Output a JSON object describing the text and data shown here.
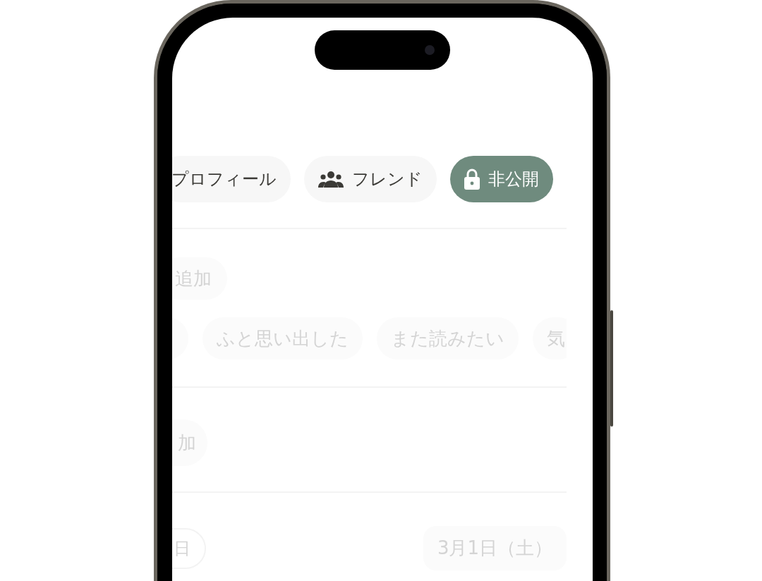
{
  "visibility_options": [
    {
      "label": "プロフィール",
      "kind": "plain",
      "selected": false
    },
    {
      "label": "フレンド",
      "kind": "friends",
      "selected": false
    },
    {
      "label": "非公開",
      "kind": "private",
      "selected": true
    }
  ],
  "tag_add_button": {
    "label": "追加"
  },
  "tags": [
    {
      "label": "ふと思い出した"
    },
    {
      "label": "また読みたい"
    },
    {
      "label": "気"
    }
  ],
  "second_add_button": {
    "label": "加"
  },
  "date_row": {
    "label": "日",
    "value": "3月1日（土）"
  }
}
